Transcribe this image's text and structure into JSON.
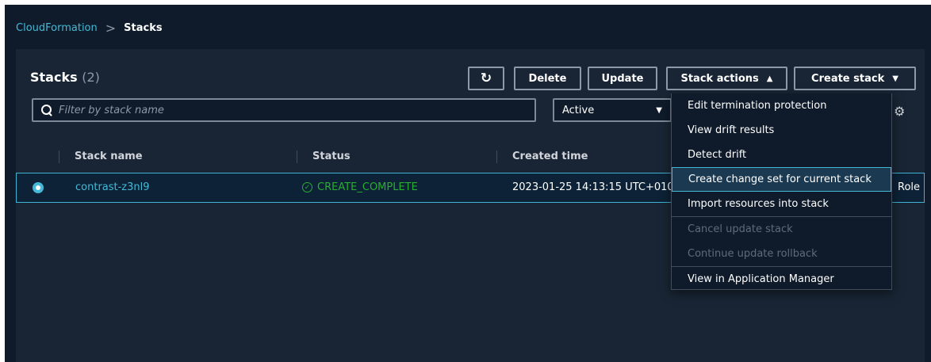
{
  "breadcrumb": {
    "root": "CloudFormation",
    "separator": ">",
    "current": "Stacks"
  },
  "header": {
    "title": "Stacks",
    "count": "(2)"
  },
  "toolbar": {
    "refresh_icon": "refresh-icon",
    "delete_label": "Delete",
    "update_label": "Update",
    "actions_label": "Stack actions",
    "actions_caret": "▲",
    "create_label": "Create stack",
    "create_caret": "▼"
  },
  "search": {
    "placeholder": "Filter by stack name",
    "value": ""
  },
  "filter": {
    "selected": "Active",
    "caret": "▼"
  },
  "table": {
    "columns": [
      "Stack name",
      "Status",
      "Created time"
    ],
    "rows": [
      {
        "name": "contrast-z3nl9",
        "status": "CREATE_COMPLETE",
        "created": "2023-01-25 14:13:15 UTC+010",
        "extra": "Role"
      }
    ]
  },
  "menu": {
    "items": [
      {
        "label": "Edit termination protection",
        "state": "enabled"
      },
      {
        "label": "View drift results",
        "state": "enabled"
      },
      {
        "label": "Detect drift",
        "state": "enabled"
      },
      {
        "label": "Create change set for current stack",
        "state": "highlighted"
      },
      {
        "label": "Import resources into stack",
        "state": "enabled"
      },
      {
        "label": "Cancel update stack",
        "state": "disabled"
      },
      {
        "label": "Continue update rollback",
        "state": "disabled"
      },
      {
        "label": "View in Application Manager",
        "state": "enabled"
      }
    ]
  },
  "colors": {
    "background": "#0f1b2a",
    "panel": "#192534",
    "accent": "#44b9d6",
    "success": "#29ad32"
  }
}
